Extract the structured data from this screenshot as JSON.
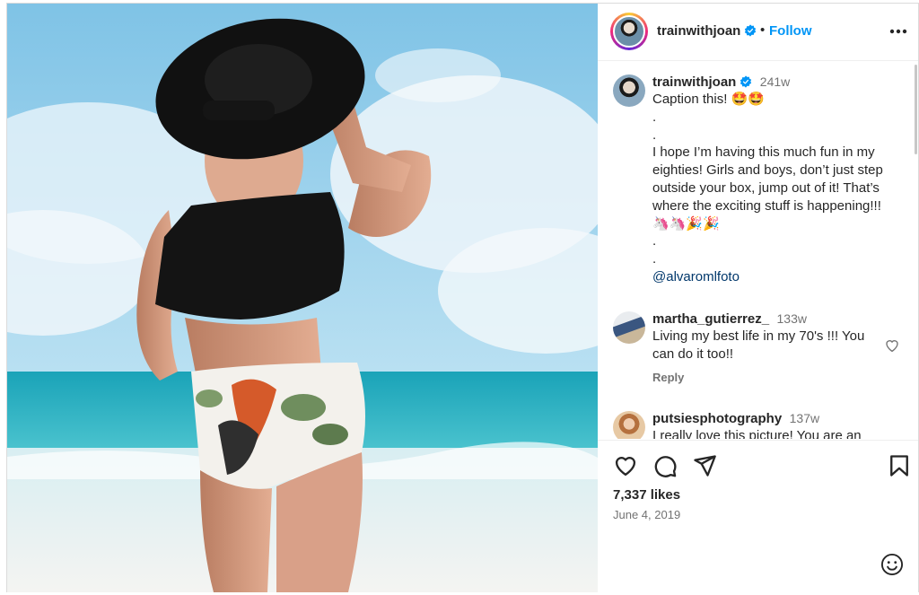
{
  "post": {
    "username": "trainwithjoan",
    "follow_label": "Follow",
    "separator": "•"
  },
  "caption": {
    "username": "trainwithjoan",
    "time": "241w",
    "text": "Caption this! 🤩🤩\n.\n.\nI hope I’m having this much fun in my eighties! Girls and boys, don’t just step outside your box, jump out of it! That’s where the exciting stuff is happening!!! 🦄🦄🎉🎉\n.\n.",
    "mention": "@alvaromlfoto"
  },
  "comments": [
    {
      "username": "martha_gutierrez_",
      "time": "133w",
      "text": "Living my best life in my 70's !!! You can do it too!!",
      "reply_label": "Reply"
    },
    {
      "username": "putsiesphotography",
      "time": "137w",
      "text": "I really love this picture! You are an"
    }
  ],
  "stats": {
    "likes": "7,337 likes",
    "date": "June 4, 2019"
  },
  "icons": {
    "more": "more-options-icon",
    "like": "heart-icon",
    "comment": "comment-icon",
    "share": "share-icon",
    "save": "bookmark-icon",
    "emoji": "emoji-icon",
    "verified": "verified-badge-icon"
  },
  "colors": {
    "accent": "#0095f6",
    "verified": "#0095f6",
    "muted": "#737373",
    "text": "#262626"
  }
}
